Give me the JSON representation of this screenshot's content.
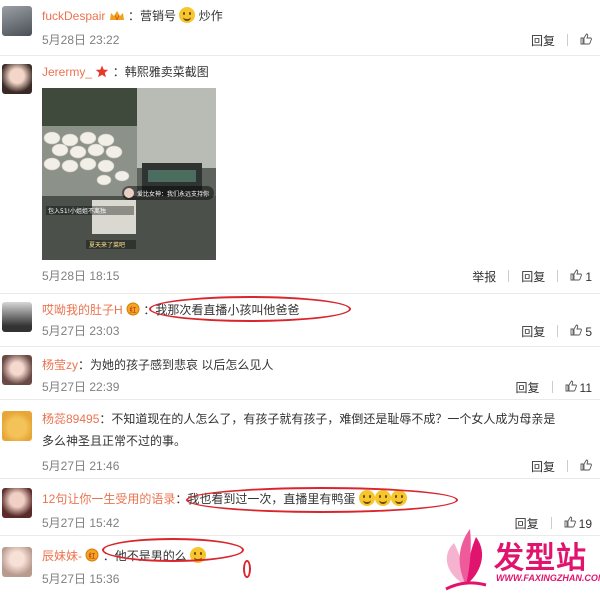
{
  "comments": [
    {
      "user": "fuckDespair",
      "text": "：营销号",
      "time": "5月28日 23:22",
      "reply": "回复",
      "likes": ""
    },
    {
      "user": "Jerermy_",
      "text": "：韩熙雅卖菜截图",
      "time": "5月28日 18:15",
      "report": "举报",
      "reply": "回复",
      "likes": "1"
    },
    {
      "user": "哎呦我的肚子H",
      "text": "：我那次看直播小孩叫他爸爸",
      "time": "5月27日 23:03",
      "reply": "回复",
      "likes": "5"
    },
    {
      "user": "杨莹zy",
      "text": "：为她的孩子感到悲哀 以后怎么见人",
      "time": "5月27日 22:39",
      "reply": "回复",
      "likes": "11"
    },
    {
      "user": "杨蕊89495",
      "text": "：不知道现在的人怎么了，有孩子就有孩子，难倒还是耻辱不成？一个女人成为母亲是",
      "text2": "多么神圣且正常不过的事。",
      "time": "5月27日 21:46",
      "reply": "回复",
      "likes": ""
    },
    {
      "user": "12句让你一生受用的语录",
      "text": "：我也看到过一次，直播里有鸭蛋",
      "time": "5月27日 15:42",
      "reply": "回复",
      "likes": "19"
    },
    {
      "user": "辰妹妹-",
      "text": "：他不是男的么",
      "time": "5月27日 15:36",
      "reply": "回复",
      "likes": ""
    }
  ],
  "photo_overlay": {
    "caption_line1": "爱比女神：我们永远支持你",
    "caption_line2": "包入51!小姐姐不离独",
    "caption_line3": "夏天来了菜吧"
  },
  "watermark": {
    "title": "发型站",
    "url": "WWW.FAXINGZHAN.COM"
  },
  "colors": {
    "username": "#eb7350",
    "time": "#808080",
    "highlight_oval": "#d9252b",
    "watermark": "#e0146e"
  }
}
